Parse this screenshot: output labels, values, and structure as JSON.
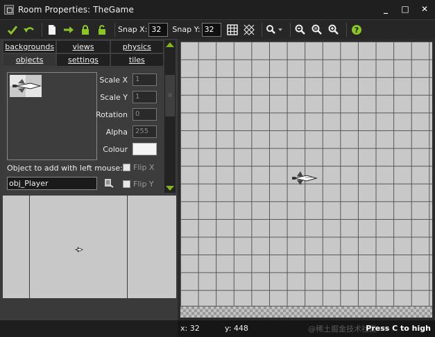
{
  "window": {
    "title": "Room Properties: TheGame",
    "minimize": "_",
    "maximize": "□",
    "close": "✕"
  },
  "toolbar": {
    "snap_x_label": "Snap X:",
    "snap_x_value": "32",
    "snap_y_label": "Snap Y:",
    "snap_y_value": "32",
    "icons": [
      "ok-check-icon",
      "undo-icon",
      "new-page-icon",
      "shift-arrow-icon",
      "lock-icon",
      "unlock-icon",
      "grid-icon",
      "isometric-grid-icon",
      "zoom-menu-icon",
      "zoom-out-icon",
      "zoom-reset-icon",
      "zoom-in-icon",
      "help-icon"
    ]
  },
  "tabs": {
    "row1": [
      "backgrounds",
      "views",
      "physics"
    ],
    "row2": [
      "objects",
      "settings",
      "tiles"
    ]
  },
  "objects_panel": {
    "scale_x_label": "Scale X",
    "scale_x_value": "1",
    "scale_y_label": "Scale Y",
    "scale_y_value": "1",
    "rotation_label": "Rotation",
    "rotation_value": "0",
    "alpha_label": "Alpha",
    "alpha_value": "255",
    "colour_label": "Colour",
    "colour_value": "#f4f4f4",
    "add_label": "Object to add with left mouse:",
    "object_name": "obj_Player",
    "flip_x": "Flip X",
    "flip_y": "Flip Y"
  },
  "status": {
    "x": "x: 32",
    "y": "y: 448",
    "hint": "Press C to high",
    "watermark": "@稀土掘金技术社区"
  },
  "colors": {
    "accent_green": "#7fb61c",
    "grid_bg": "#c8c8c8",
    "panel_bg": "#3a3a3a"
  }
}
